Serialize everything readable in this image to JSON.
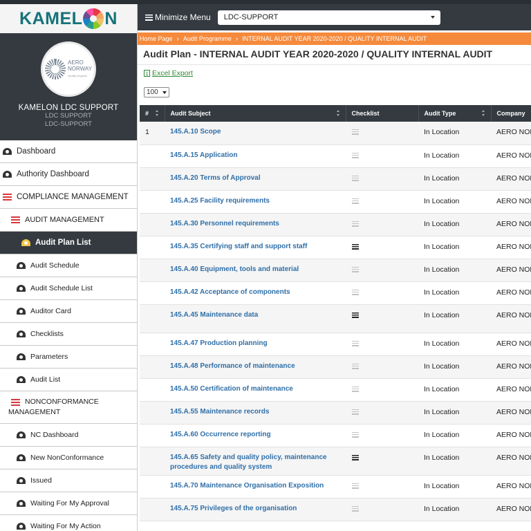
{
  "app": {
    "brand_left": "KAMEL",
    "brand_right": "N"
  },
  "profile": {
    "org": "AERO",
    "org2": "NORWAY",
    "tagline": "Quality Engines",
    "name": "KAMELON LDC SUPPORT",
    "line1": "LDC SUPPORT",
    "line2": "LDC-SUPPORT"
  },
  "sidebar": {
    "items": [
      {
        "label": "Dashboard"
      },
      {
        "label": "Authority Dashboard"
      },
      {
        "label": "COMPLIANCE MANAGEMENT"
      },
      {
        "label": "AUDIT MANAGEMENT"
      },
      {
        "label": "Audit Plan List"
      },
      {
        "label": "Audit Schedule"
      },
      {
        "label": "Audit Schedule List"
      },
      {
        "label": "Auditor Card"
      },
      {
        "label": "Checklists"
      },
      {
        "label": "Parameters"
      },
      {
        "label": "Audit List"
      },
      {
        "label": "NONCONFORMANCE",
        "label2": "MANAGEMENT"
      },
      {
        "label": "NC Dashboard"
      },
      {
        "label": "New NonConformance"
      },
      {
        "label": "Issued"
      },
      {
        "label": "Waiting For My Approval"
      },
      {
        "label": "Waiting For My Action"
      }
    ]
  },
  "header": {
    "minimize_label": "Minimize Menu",
    "org_select_value": "LDC-SUPPORT"
  },
  "breadcrumb": {
    "home": "Home Page",
    "programme": "Audit Programme",
    "current": "INTERNAL AUDIT YEAR 2020-2020 / QUALITY INTERNAL AUDIT"
  },
  "page": {
    "title": "Audit Plan - INTERNAL AUDIT YEAR 2020-2020 / QUALITY INTERNAL AUDIT",
    "excel_label": "Excel Export",
    "page_size": "100"
  },
  "table": {
    "columns": [
      "#",
      "Audit Subject",
      "Checklist",
      "Audit Type",
      "Company"
    ],
    "rows": [
      {
        "num": "1",
        "code": "145.A.10",
        "subject": "Scope",
        "type": "In Location",
        "company": "AERO NORWAY"
      },
      {
        "num": "",
        "code": "145.A.15",
        "subject": "Application",
        "type": "In Location",
        "company": "AERO NORWAY"
      },
      {
        "num": "",
        "code": "145.A.20",
        "subject": "Terms of Approval",
        "type": "In Location",
        "company": "AERO NORWAY"
      },
      {
        "num": "",
        "code": "145.A.25",
        "subject": "Facility requirements",
        "type": "In Location",
        "company": "AERO NORWAY"
      },
      {
        "num": "",
        "code": "145.A.30",
        "subject": "Personnel requirements",
        "type": "In Location",
        "company": "AERO NORWAY"
      },
      {
        "num": "",
        "code": "145.A.35",
        "subject": "Certifying staff and support staff",
        "type": "In Location",
        "company": "AERO NORWAY"
      },
      {
        "num": "",
        "code": "145.A.40",
        "subject": "Equipment, tools and material",
        "type": "In Location",
        "company": "AERO NORWAY"
      },
      {
        "num": "",
        "code": "145.A.42",
        "subject": "Acceptance of components",
        "type": "In Location",
        "company": "AERO NORWAY"
      },
      {
        "num": "",
        "code": "145.A.45",
        "subject": "Maintenance data",
        "type": "In Location",
        "company": "AERO NORWAY"
      },
      {
        "num": "",
        "code": "145.A.47",
        "subject": "Production planning",
        "type": "In Location",
        "company": "AERO NORWAY"
      },
      {
        "num": "",
        "code": "145.A.48",
        "subject": "Performance of maintenance",
        "type": "In Location",
        "company": "AERO NORWAY"
      },
      {
        "num": "",
        "code": "145.A.50",
        "subject": "Certification of maintenance",
        "type": "In Location",
        "company": "AERO NORWAY"
      },
      {
        "num": "",
        "code": "145.A.55",
        "subject": "Maintenance records",
        "type": "In Location",
        "company": "AERO NORWAY"
      },
      {
        "num": "",
        "code": "145.A.60",
        "subject": "Occurrence reporting",
        "type": "In Location",
        "company": "AERO NORWAY"
      },
      {
        "num": "",
        "code": "145.A.65",
        "subject": "Safety and quality policy, maintenance procedures and quality system",
        "type": "In Location",
        "company": "AERO NORWAY"
      },
      {
        "num": "",
        "code": "145.A.70",
        "subject": "Maintenance Organisation Exposition",
        "type": "In Location",
        "company": "AERO NORWAY"
      },
      {
        "num": "",
        "code": "145.A.75",
        "subject": "Privileges of the organisation",
        "type": "In Location",
        "company": "AERO NORWAY"
      }
    ]
  }
}
